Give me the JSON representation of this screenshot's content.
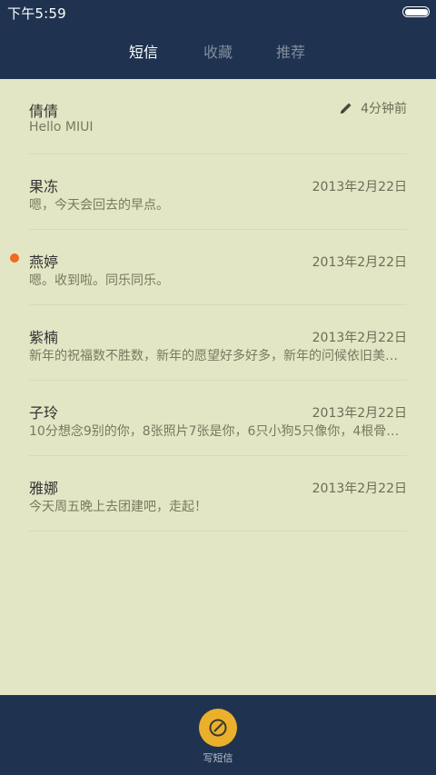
{
  "status_bar": {
    "time": "下午5:59"
  },
  "tabs": [
    {
      "label": "短信",
      "active": true
    },
    {
      "label": "收藏",
      "active": false
    },
    {
      "label": "推荐",
      "active": false
    }
  ],
  "conversations": [
    {
      "name": "倩倩",
      "snippet": "Hello MIUI",
      "time": "4分钟前",
      "draft": true,
      "unread": false
    },
    {
      "name": "果冻",
      "snippet": "嗯，今天会回去的早点。",
      "time": "2013年2月22日",
      "draft": false,
      "unread": false
    },
    {
      "name": "燕婷",
      "snippet": "嗯。收到啦。同乐同乐。",
      "time": "2013年2月22日",
      "draft": false,
      "unread": true
    },
    {
      "name": "紫楠",
      "snippet": "新年的祝福数不胜数，新年的愿望好多好多，新年的问候依旧美好...",
      "time": "2013年2月22日",
      "draft": false,
      "unread": false
    },
    {
      "name": "子玲",
      "snippet": "10分想念9别的你，8张照片7张是你，6只小狗5只像你，4根骨头...",
      "time": "2013年2月22日",
      "draft": false,
      "unread": false
    },
    {
      "name": "雅娜",
      "snippet": "今天周五晚上去团建吧，走起！",
      "time": "2013年2月22日",
      "draft": false,
      "unread": false
    }
  ],
  "compose": {
    "label": "写短信",
    "icon": "compose-icon"
  },
  "colors": {
    "header_bg": "#1f3350",
    "list_bg": "#e2e6c4",
    "unread_dot": "#f06a1f",
    "compose_button": "#eab02b"
  }
}
